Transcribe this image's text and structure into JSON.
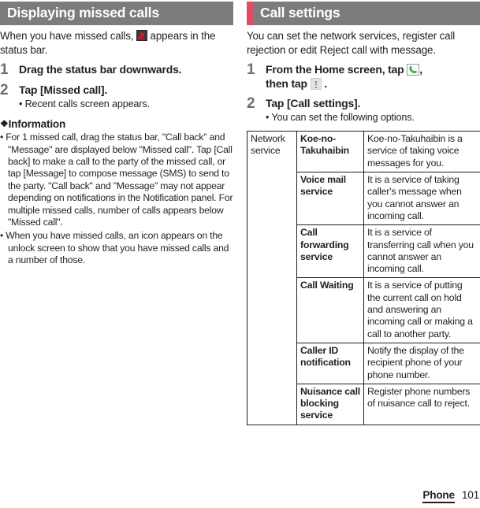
{
  "page": {
    "footer_label": "Phone",
    "page_number": "101",
    "accent_color": "#e04a63",
    "header_bg": "#7c7c7c",
    "header_text_color": "#ffffff",
    "step_number_color": "#6d6e71"
  },
  "left_column": {
    "heading": "Displaying missed calls",
    "intro_before_icon": "When you have missed calls,",
    "intro_icon": "missed-call-icon",
    "intro_after_icon": "appears in the status bar.",
    "steps": [
      {
        "number": "1",
        "title": "Drag the status bar downwards.",
        "bullets": []
      },
      {
        "number": "2",
        "title": "Tap [Missed call].",
        "bullets": [
          "• Recent calls screen appears."
        ]
      }
    ],
    "information": {
      "marker": "❖",
      "title": "Information",
      "items": [
        "• For 1 missed call, drag the status bar, \"Call back\" and \"Message\" are displayed below \"Missed call\". Tap [Call back] to make a call to the party of the missed call, or tap [Message] to compose message (SMS) to send to the party. \"Call back\" and \"Message\" may not appear depending on notifications in the Notification panel. For multiple missed calls, number of calls appears below \"Missed call\".",
        "• When you have missed calls, an icon appears on the unlock screen to show that you have missed calls and a number of those."
      ]
    }
  },
  "right_column": {
    "heading": "Call settings",
    "intro": "You can set the network services, register call rejection or edit Reject call with message.",
    "steps": [
      {
        "number": "1",
        "title_part1": "From the Home screen, tap",
        "icon1": "phone-handset-icon",
        "title_part2": ",",
        "title_part3": "then tap",
        "icon2": "overflow-menu-icon",
        "title_part4": "."
      },
      {
        "number": "2",
        "title": "Tap [Call settings].",
        "bullets": [
          "• You can set the following options."
        ]
      }
    ],
    "options_table": {
      "category": "Network service",
      "rows": [
        {
          "name": "Koe-no-Takuhaibin",
          "description": "Koe-no-Takuhaibin is a service of taking voice messages for you."
        },
        {
          "name": "Voice mail service",
          "description": "It is a service of taking caller's message when you cannot answer an incoming call."
        },
        {
          "name": "Call forwarding service",
          "description": "It is a service of transferring call when you cannot answer an incoming call."
        },
        {
          "name": "Call Waiting",
          "description": "It is a service of putting the current call on hold and answering an incoming call or making a call to another party."
        },
        {
          "name": "Caller ID notification",
          "description": "Notify the display of the recipient phone of your phone number."
        },
        {
          "name": "Nuisance call blocking service",
          "description": "Register phone numbers of nuisance call to reject."
        }
      ]
    }
  }
}
